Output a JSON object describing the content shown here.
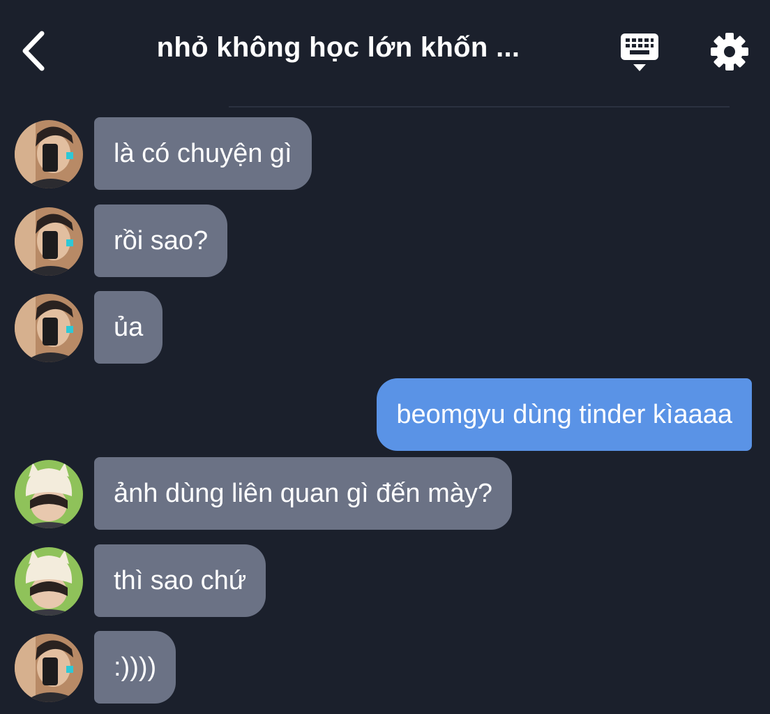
{
  "header": {
    "title": "nhỏ không học lớn khốn ...",
    "back_icon": "chevron-left-icon",
    "keyboard_icon": "keyboard-icon",
    "settings_icon": "gear-icon"
  },
  "colors": {
    "background": "#1b202c",
    "incoming_bubble": "#6b7285",
    "outgoing_bubble": "#5a93e6",
    "text": "#ffffff"
  },
  "messages": [
    {
      "direction": "incoming",
      "avatar": "avatar-boy-mirror-selfie",
      "text": "là có chuyện gì"
    },
    {
      "direction": "incoming",
      "avatar": "avatar-boy-mirror-selfie",
      "text": "rồi sao?"
    },
    {
      "direction": "incoming",
      "avatar": "avatar-boy-mirror-selfie",
      "text": "ủa"
    },
    {
      "direction": "outgoing",
      "text": "beomgyu dùng tinder kìaaaa"
    },
    {
      "direction": "incoming",
      "avatar": "avatar-boy-white-beanie",
      "text": "ảnh dùng liên quan gì đến mày?"
    },
    {
      "direction": "incoming",
      "avatar": "avatar-boy-white-beanie",
      "text": "thì sao chứ"
    },
    {
      "direction": "incoming",
      "avatar": "avatar-boy-mirror-selfie",
      "text": ":))))"
    }
  ]
}
